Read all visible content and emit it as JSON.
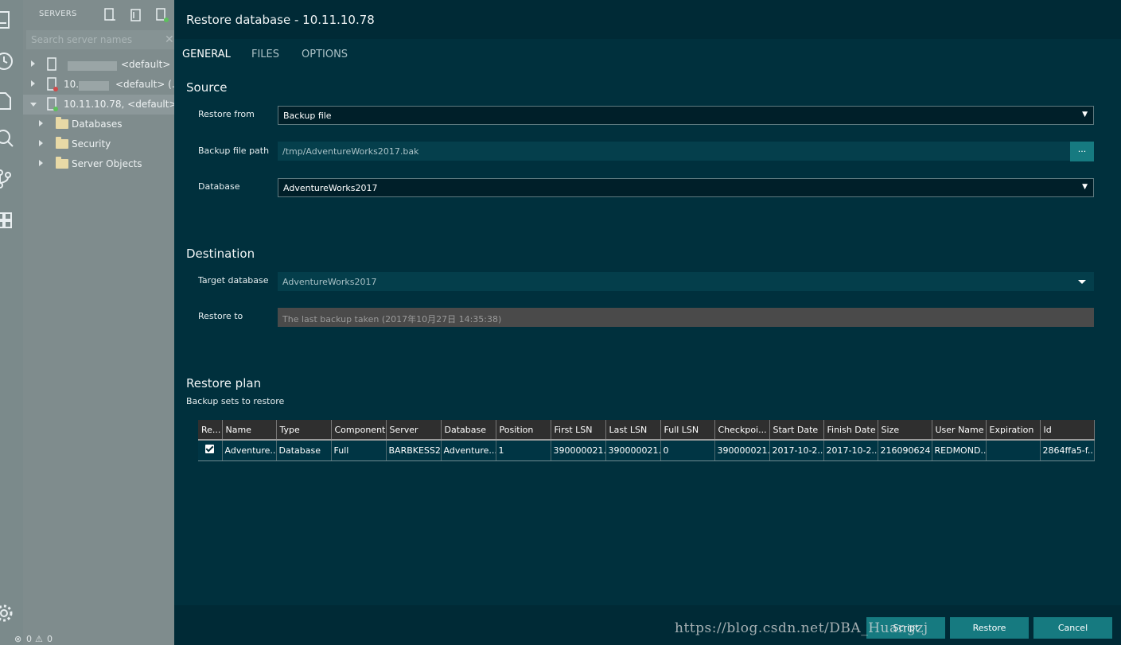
{
  "sidebar": {
    "header": "SERVERS",
    "search_placeholder": "Search server names",
    "servers": [
      {
        "prefix": "",
        "label": "<default> ..."
      },
      {
        "prefix": "10.",
        "label": "<default> (..."
      },
      {
        "prefix": "",
        "label": "10.11.10.78, <default> ..."
      }
    ],
    "children": [
      "Databases",
      "Security",
      "Server Objects"
    ],
    "status": {
      "errors": "0",
      "warnings": "0"
    }
  },
  "dialog": {
    "title": "Restore database - 10.11.10.78",
    "tabs": [
      "GENERAL",
      "FILES",
      "OPTIONS"
    ],
    "source": {
      "heading": "Source",
      "restore_from_label": "Restore from",
      "restore_from_value": "Backup file",
      "backup_path_label": "Backup file path",
      "backup_path_value": "/tmp/AdventureWorks2017.bak",
      "browse_label": "...",
      "database_label": "Database",
      "database_value": "AdventureWorks2017"
    },
    "destination": {
      "heading": "Destination",
      "target_label": "Target database",
      "target_value": "AdventureWorks2017",
      "restore_to_label": "Restore to",
      "restore_to_value": "The last backup taken (2017年10月27日 14:35:38)"
    },
    "plan": {
      "heading": "Restore plan",
      "subheading": "Backup sets to restore",
      "columns": [
        "Re...",
        "Name",
        "Type",
        "Component",
        "Server",
        "Database",
        "Position",
        "First LSN",
        "Last LSN",
        "Full LSN",
        "Checkpoi...",
        "Start Date",
        "Finish Date",
        "Size",
        "User Name",
        "Expiration",
        "Id"
      ],
      "rows": [
        {
          "checked": true,
          "cells": [
            "Adventure...",
            "Database",
            "Full",
            "BARBKESS2...",
            "Adventure...",
            "1",
            "390000021...",
            "390000021...",
            "0",
            "390000021...",
            "2017-10-2...",
            "2017-10-2...",
            "216090624",
            "REDMOND...",
            "",
            "2864ffa5-f..."
          ]
        }
      ]
    },
    "buttons": {
      "script": "Script",
      "restore": "Restore",
      "cancel": "Cancel"
    },
    "watermark": "https://blog.csdn.net/DBA_Huangzj"
  }
}
